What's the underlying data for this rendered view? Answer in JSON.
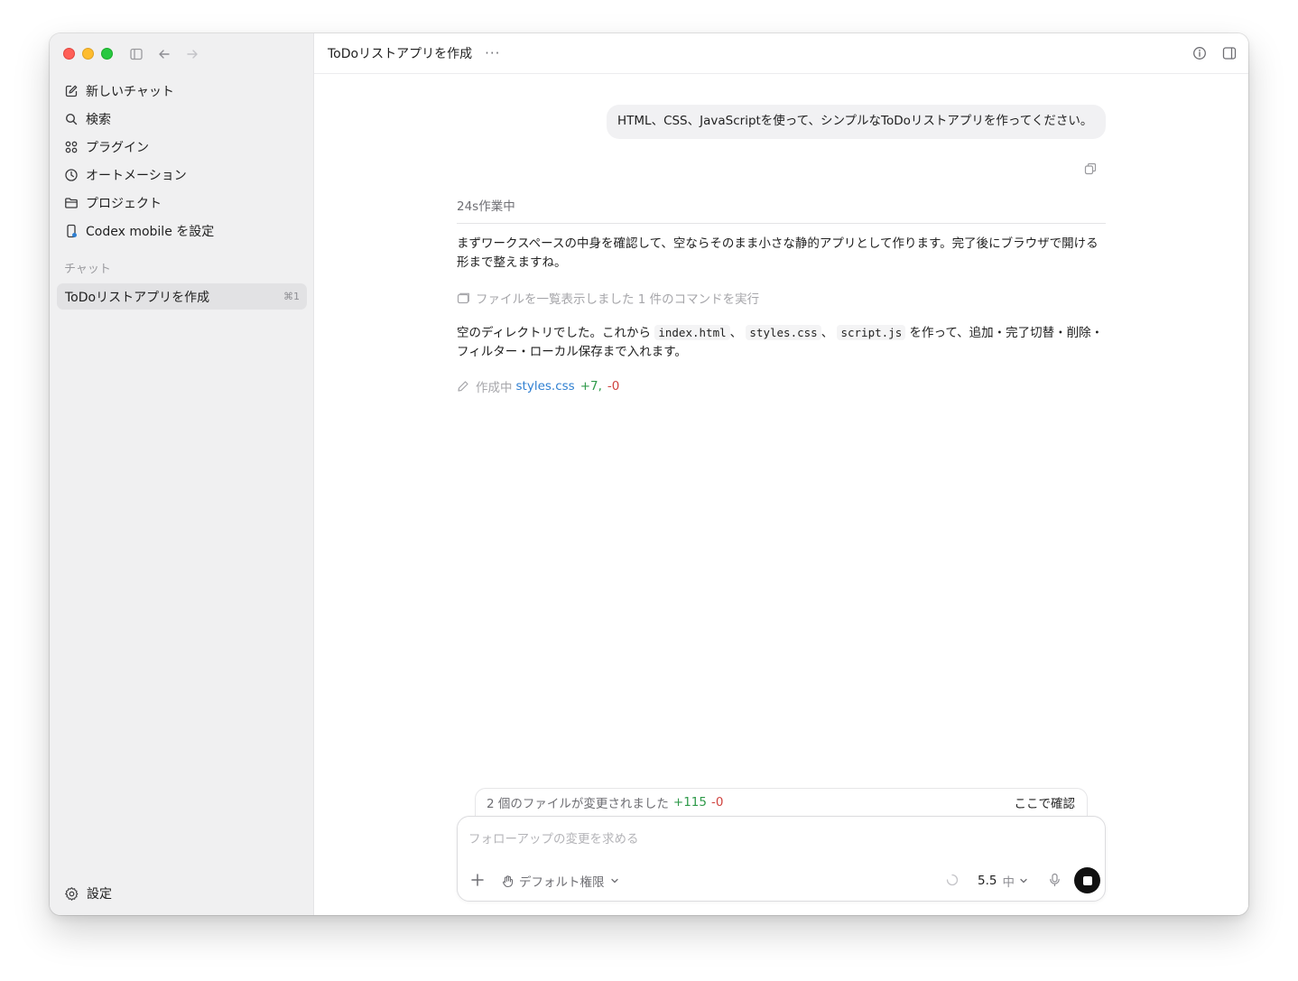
{
  "sidebar": {
    "items": [
      {
        "label": "新しいチャット",
        "icon": "compose-icon"
      },
      {
        "label": "検索",
        "icon": "search-icon"
      },
      {
        "label": "プラグイン",
        "icon": "plugin-grid-icon"
      },
      {
        "label": "オートメーション",
        "icon": "clock-icon"
      },
      {
        "label": "プロジェクト",
        "icon": "folder-icon"
      },
      {
        "label": "Codex mobile を設定",
        "icon": "phone-icon"
      }
    ],
    "section_label": "チャット",
    "chats": [
      {
        "label": "ToDoリストアプリを作成",
        "shortcut": "⌘1"
      }
    ],
    "settings_label": "設定"
  },
  "header": {
    "title": "ToDoリストアプリを作成",
    "more": "···"
  },
  "conversation": {
    "user_message": "HTML、CSS、JavaScriptを使って、シンプルなToDoリストアプリを作ってください。",
    "status": "24s作業中",
    "paragraph1": "まずワークスペースの中身を確認して、空ならそのまま小さな静的アプリとして作ります。完了後にブラウザで開ける形まで整えますね。",
    "command_summary": "ファイルを一覧表示しました 1 件のコマンドを実行",
    "paragraph2": {
      "prefix": "空のディレクトリでした。これから",
      "file1": "index.html",
      "sep1": "、",
      "file2": "styles.css",
      "sep2": "、",
      "file3": "script.js",
      "suffix": "を作って、追加・完了切替・削除・フィルター・ローカル保存まで入れます。"
    },
    "edit": {
      "label": "作成中",
      "file": "styles.css",
      "added": "+7,",
      "removed": "-0"
    }
  },
  "changes_bar": {
    "summary": "2 個のファイルが変更されました",
    "added": "+115",
    "removed": "-0",
    "review": "ここで確認"
  },
  "composer": {
    "placeholder": "フォローアップの変更を求める",
    "permission": "デフォルト権限",
    "model": "5.5",
    "effort": "中"
  },
  "colors": {
    "sidebar_bg": "#f0f0f1",
    "accent_link": "#2f7fd1",
    "added": "#2f9a4a",
    "removed": "#d0433f"
  }
}
